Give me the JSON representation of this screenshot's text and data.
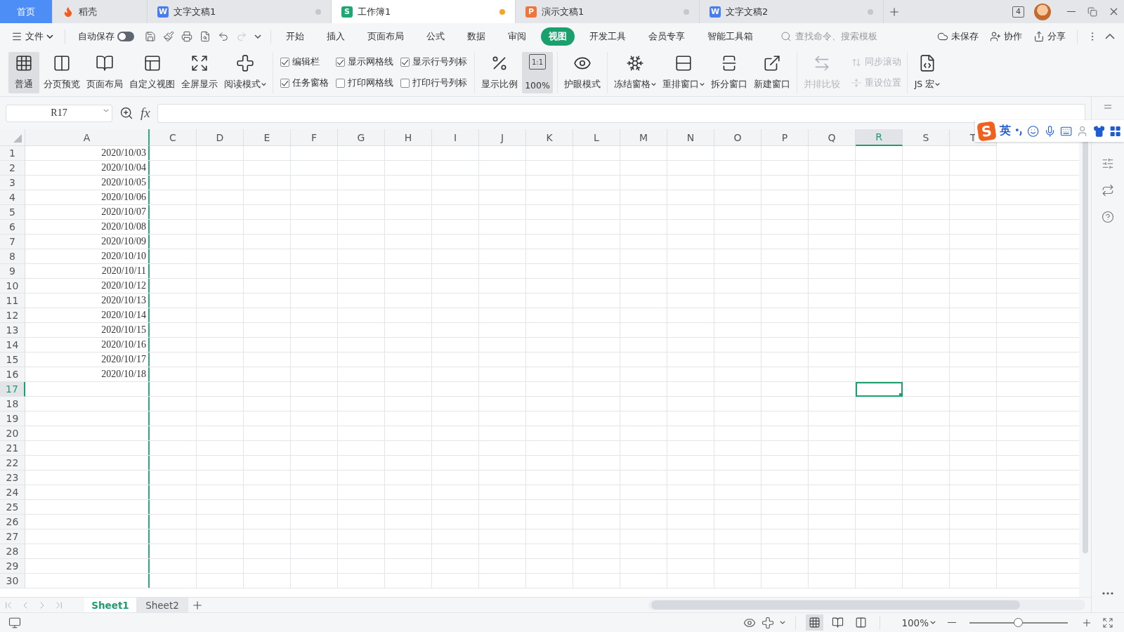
{
  "tabs": [
    {
      "kind": "home",
      "label": "首页",
      "selected": false
    },
    {
      "kind": "docer",
      "label": "稻壳",
      "selected": false
    },
    {
      "kind": "doc",
      "badge": "W",
      "color": "#4a7cf0",
      "label": "文字文稿1",
      "selected": false,
      "modified": false
    },
    {
      "kind": "doc",
      "badge": "S",
      "color": "#1fa672",
      "label": "工作簿1",
      "selected": true,
      "modified": true
    },
    {
      "kind": "doc",
      "badge": "P",
      "color": "#f0753a",
      "label": "演示文稿1",
      "selected": false,
      "modified": false
    },
    {
      "kind": "doc",
      "badge": "W",
      "color": "#4a7cf0",
      "label": "文字文稿2",
      "selected": false,
      "modified": false
    }
  ],
  "window_count": "4",
  "menu": {
    "file": "文件",
    "autosave": {
      "label": "自动保存",
      "on": false
    },
    "tabs": [
      {
        "label": "开始",
        "selected": false
      },
      {
        "label": "插入",
        "selected": false
      },
      {
        "label": "页面布局",
        "selected": false
      },
      {
        "label": "公式",
        "selected": false
      },
      {
        "label": "数据",
        "selected": false
      },
      {
        "label": "审阅",
        "selected": false
      },
      {
        "label": "视图",
        "selected": true
      },
      {
        "label": "开发工具",
        "selected": false
      },
      {
        "label": "会员专享",
        "selected": false
      },
      {
        "label": "智能工具箱",
        "selected": false
      }
    ],
    "search": {
      "placeholder": "查找命令、搜索模板"
    },
    "actions": [
      {
        "kind": "cloud",
        "label": "未保存"
      },
      {
        "kind": "collab",
        "label": "协作"
      },
      {
        "kind": "share",
        "label": "分享"
      }
    ]
  },
  "ribbon": [
    {
      "kind": "big",
      "items": [
        {
          "kind": "normal",
          "label": "普通",
          "selected": true,
          "dropdown": false,
          "disabled": false
        },
        {
          "kind": "pagebreak",
          "label": "分页预览",
          "selected": false,
          "dropdown": false,
          "disabled": false
        },
        {
          "kind": "pagelayout",
          "label": "页面布局",
          "selected": false,
          "dropdown": false,
          "disabled": false
        },
        {
          "kind": "customview",
          "label": "自定义视图",
          "selected": false,
          "dropdown": false,
          "disabled": false
        },
        {
          "kind": "fullscreen",
          "label": "全屏显示",
          "selected": false,
          "dropdown": false,
          "disabled": false
        },
        {
          "kind": "reading",
          "label": "阅读模式",
          "selected": false,
          "dropdown": true,
          "disabled": false
        }
      ]
    },
    {
      "kind": "checks",
      "items": [
        {
          "label": "编辑栏",
          "checked": true
        },
        {
          "label": "任务窗格",
          "checked": true
        },
        {
          "label": "显示网格线",
          "checked": true
        },
        {
          "label": "打印网格线",
          "checked": false
        },
        {
          "label": "显示行号列标",
          "checked": true
        },
        {
          "label": "打印行号列标",
          "checked": false
        }
      ]
    },
    {
      "kind": "big",
      "items": [
        {
          "kind": "ratio",
          "label": "显示比例",
          "selected": false,
          "dropdown": false,
          "disabled": false
        },
        {
          "kind": "actual",
          "icon_text": "1:1",
          "label": "100%",
          "selected": true,
          "dropdown": false,
          "disabled": false
        }
      ]
    },
    {
      "kind": "big",
      "items": [
        {
          "kind": "eyecare",
          "label": "护眼模式",
          "selected": false,
          "dropdown": false,
          "disabled": false
        }
      ]
    },
    {
      "kind": "big",
      "items": [
        {
          "kind": "freeze",
          "label": "冻结窗格",
          "selected": false,
          "dropdown": true,
          "disabled": false
        },
        {
          "kind": "arrange",
          "label": "重排窗口",
          "selected": false,
          "dropdown": true,
          "disabled": false
        },
        {
          "kind": "split",
          "label": "拆分窗口",
          "selected": false,
          "dropdown": false,
          "disabled": false
        },
        {
          "kind": "newwindow",
          "label": "新建窗口",
          "selected": false,
          "dropdown": false,
          "disabled": false
        }
      ]
    },
    {
      "kind": "big",
      "items": [
        {
          "kind": "compare",
          "label": "并排比较",
          "selected": false,
          "dropdown": false,
          "disabled": true
        }
      ],
      "small": [
        {
          "kind": "sync",
          "label": "同步滚动",
          "disabled": true
        },
        {
          "kind": "reset",
          "label": "重设位置",
          "disabled": true
        }
      ]
    },
    {
      "kind": "big",
      "items": [
        {
          "kind": "macro",
          "label": "JS 宏",
          "selected": false,
          "dropdown": true,
          "disabled": false
        }
      ]
    }
  ],
  "formula_bar": {
    "name_box": "R17",
    "fx": "fx"
  },
  "ime": {
    "logo": "S",
    "mode": "英"
  },
  "columns": [
    {
      "label": "A",
      "selected": false,
      "edge_line": true
    },
    {
      "label": "C",
      "selected": false,
      "edge_line": false
    },
    {
      "label": "D",
      "selected": false,
      "edge_line": false
    },
    {
      "label": "E",
      "selected": false,
      "edge_line": false
    },
    {
      "label": "F",
      "selected": false,
      "edge_line": false
    },
    {
      "label": "G",
      "selected": false,
      "edge_line": false
    },
    {
      "label": "H",
      "selected": false,
      "edge_line": false
    },
    {
      "label": "I",
      "selected": false,
      "edge_line": false
    },
    {
      "label": "J",
      "selected": false,
      "edge_line": false
    },
    {
      "label": "K",
      "selected": false,
      "edge_line": false
    },
    {
      "label": "L",
      "selected": false,
      "edge_line": false
    },
    {
      "label": "M",
      "selected": false,
      "edge_line": false
    },
    {
      "label": "N",
      "selected": false,
      "edge_line": false
    },
    {
      "label": "O",
      "selected": false,
      "edge_line": false
    },
    {
      "label": "P",
      "selected": false,
      "edge_line": false
    },
    {
      "label": "Q",
      "selected": false,
      "edge_line": false
    },
    {
      "label": "R",
      "selected": true,
      "edge_line": false
    },
    {
      "label": "S",
      "selected": false,
      "edge_line": false
    },
    {
      "label": "T",
      "selected": false,
      "edge_line": false
    }
  ],
  "rows": [
    {
      "number": "1",
      "a": "2020/10/03",
      "selected": false
    },
    {
      "number": "2",
      "a": "2020/10/04",
      "selected": false
    },
    {
      "number": "3",
      "a": "2020/10/05",
      "selected": false
    },
    {
      "number": "4",
      "a": "2020/10/06",
      "selected": false
    },
    {
      "number": "5",
      "a": "2020/10/07",
      "selected": false
    },
    {
      "number": "6",
      "a": "2020/10/08",
      "selected": false
    },
    {
      "number": "7",
      "a": "2020/10/09",
      "selected": false
    },
    {
      "number": "8",
      "a": "2020/10/10",
      "selected": false
    },
    {
      "number": "9",
      "a": "2020/10/11",
      "selected": false
    },
    {
      "number": "10",
      "a": "2020/10/12",
      "selected": false
    },
    {
      "number": "11",
      "a": "2020/10/13",
      "selected": false
    },
    {
      "number": "12",
      "a": "2020/10/14",
      "selected": false
    },
    {
      "number": "13",
      "a": "2020/10/15",
      "selected": false
    },
    {
      "number": "14",
      "a": "2020/10/16",
      "selected": false
    },
    {
      "number": "15",
      "a": "2020/10/17",
      "selected": false
    },
    {
      "number": "16",
      "a": "2020/10/18",
      "selected": false
    },
    {
      "number": "17",
      "selected": true
    },
    {
      "number": "18",
      "selected": false
    },
    {
      "number": "19",
      "selected": false
    },
    {
      "number": "20",
      "selected": false
    },
    {
      "number": "21",
      "selected": false
    },
    {
      "number": "22",
      "selected": false
    },
    {
      "number": "23",
      "selected": false
    },
    {
      "number": "24",
      "selected": false
    },
    {
      "number": "25",
      "selected": false
    },
    {
      "number": "26",
      "selected": false
    },
    {
      "number": "27",
      "selected": false
    },
    {
      "number": "28",
      "selected": false
    },
    {
      "number": "29",
      "selected": false
    },
    {
      "number": "30",
      "selected": false
    }
  ],
  "sheets": [
    {
      "label": "Sheet1",
      "selected": true
    },
    {
      "label": "Sheet2",
      "selected": false
    }
  ],
  "status_bar": {
    "views": [
      {
        "kind": "normal",
        "selected": true
      },
      {
        "kind": "pagelayout",
        "selected": false
      },
      {
        "kind": "pagebreak",
        "selected": false
      }
    ],
    "zoom": "100%",
    "zoom_slider": {
      "level": 0.49
    }
  }
}
